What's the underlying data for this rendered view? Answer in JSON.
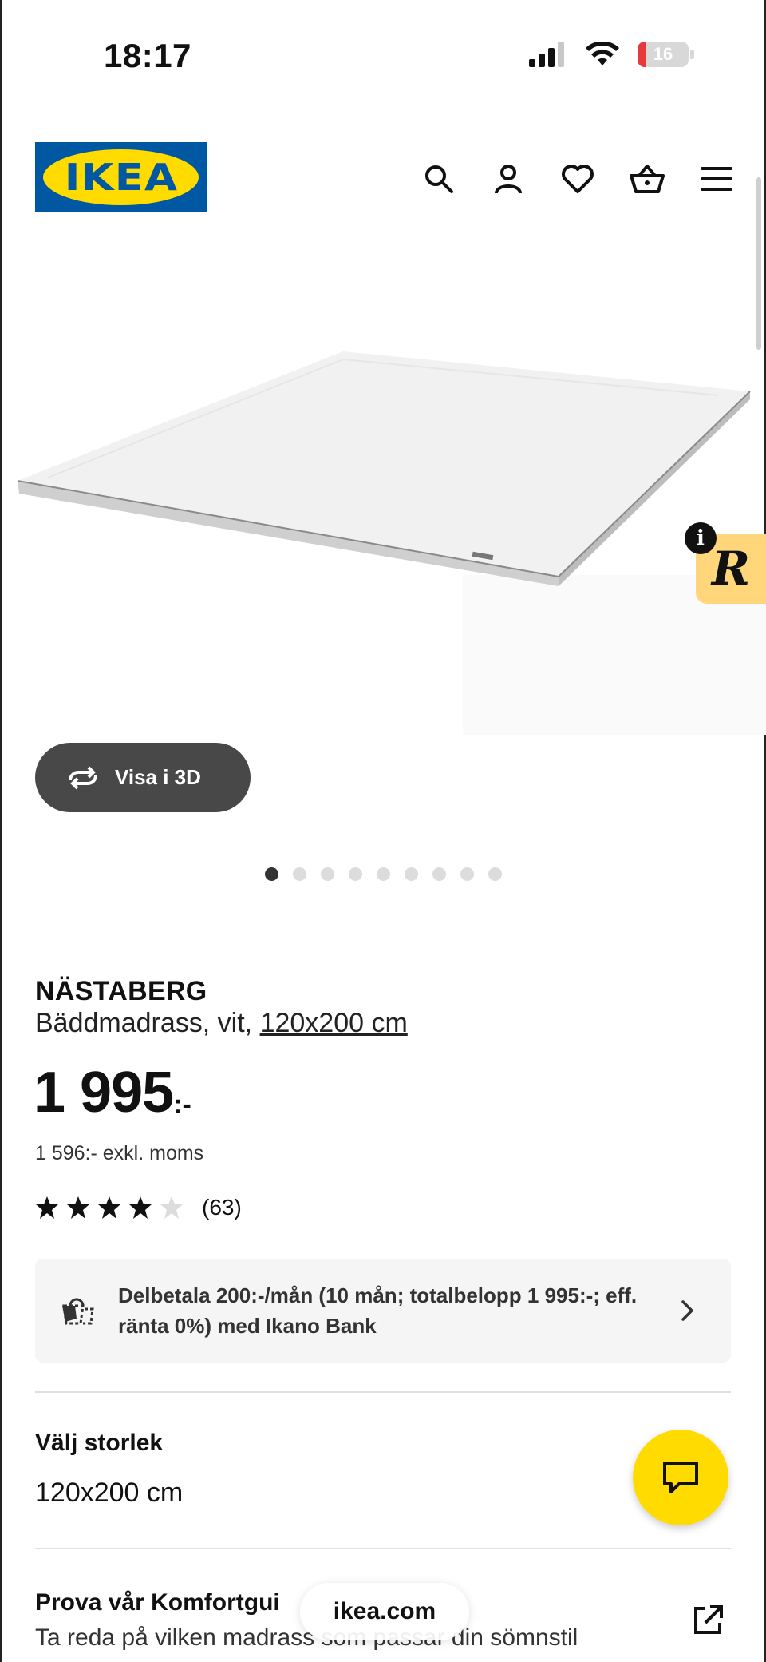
{
  "status_bar": {
    "time": "18:17",
    "battery_level": "16",
    "battery_fraction": 0.16
  },
  "header": {
    "logo_text": "IKEA",
    "icons": [
      "search-icon",
      "account-icon",
      "heart-icon",
      "cart-icon",
      "menu-icon"
    ]
  },
  "gallery": {
    "view_3d_label": "Visa i 3D",
    "image_count": 9,
    "active_index": 0
  },
  "badge": {
    "letter": "R",
    "info": "i"
  },
  "product": {
    "name": "NÄSTABERG",
    "description": "Bäddmadrass, vit, ",
    "size_link": "120x200 cm",
    "price": "1 995",
    "price_suffix": ":-",
    "price_ex_vat": "1 596:- exkl. moms",
    "rating": 4,
    "rating_max": 5,
    "rating_count": "(63)"
  },
  "installment": {
    "text": "Delbetala 200:-/mån (10 mån; totalbelopp 1 995:-; eff. ränta 0%) med Ikano Bank"
  },
  "size_selector": {
    "label": "Välj storlek",
    "value": "120x200 cm"
  },
  "comfort_guide": {
    "title": "Prova vår Komfortgui",
    "subtitle": "Ta reda på vilken madrass som passar din sömnstil"
  },
  "browser": {
    "url": "ikea.com"
  },
  "colors": {
    "ikea_blue": "#0058a3",
    "ikea_yellow": "#ffdb00",
    "badge_yellow": "#ffd77a",
    "button_dark": "#484848"
  }
}
